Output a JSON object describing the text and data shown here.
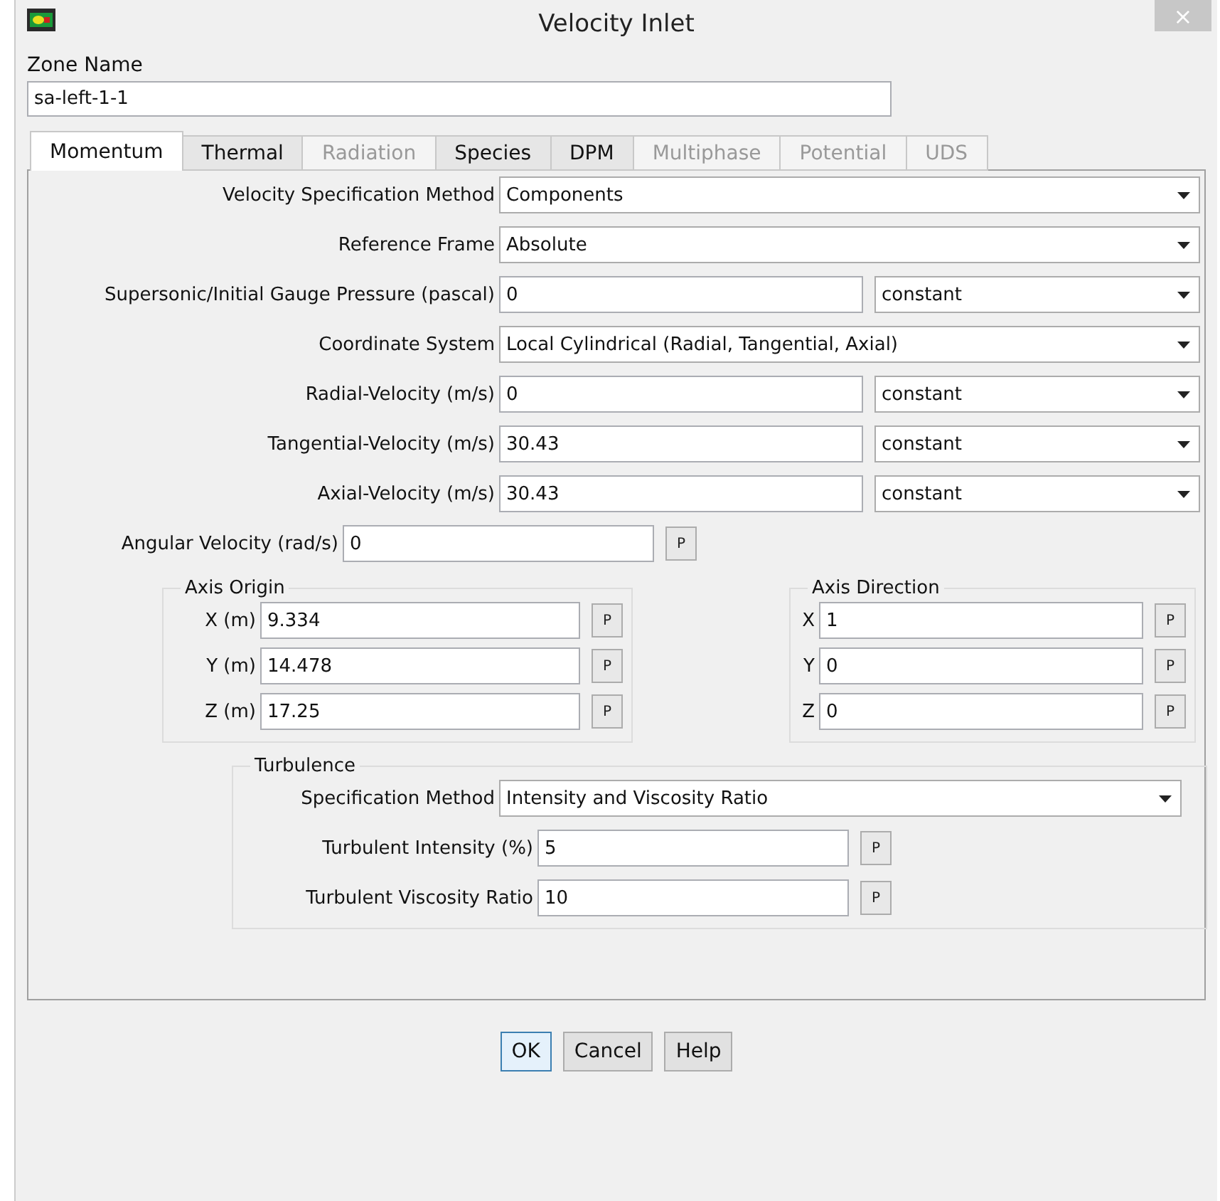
{
  "window": {
    "title": "Velocity Inlet",
    "close": "×"
  },
  "zone": {
    "label": "Zone Name",
    "value": "sa-left-1-1"
  },
  "tabs": [
    {
      "label": "Momentum",
      "selected": true,
      "disabled": false
    },
    {
      "label": "Thermal",
      "selected": false,
      "disabled": false
    },
    {
      "label": "Radiation",
      "selected": false,
      "disabled": true
    },
    {
      "label": "Species",
      "selected": false,
      "disabled": false
    },
    {
      "label": "DPM",
      "selected": false,
      "disabled": false
    },
    {
      "label": "Multiphase",
      "selected": false,
      "disabled": true
    },
    {
      "label": "Potential",
      "selected": false,
      "disabled": true
    },
    {
      "label": "UDS",
      "selected": false,
      "disabled": true
    }
  ],
  "rows": [
    {
      "kind": "select",
      "label": "Velocity Specification Method",
      "value": "Components"
    },
    {
      "kind": "select",
      "label": "Reference Frame",
      "value": "Absolute"
    },
    {
      "kind": "field_method",
      "label": "Supersonic/Initial Gauge Pressure (pascal)",
      "value": "0",
      "method": "constant"
    },
    {
      "kind": "select",
      "label": "Coordinate System",
      "value": "Local Cylindrical (Radial, Tangential, Axial)"
    },
    {
      "kind": "field_method",
      "label": "Radial-Velocity (m/s)",
      "value": "0",
      "method": "constant"
    },
    {
      "kind": "field_method",
      "label": "Tangential-Velocity (m/s)",
      "value": "30.43",
      "method": "constant"
    },
    {
      "kind": "field_method",
      "label": "Axial-Velocity (m/s)",
      "value": "30.43",
      "method": "constant"
    },
    {
      "kind": "field_p",
      "label": "Angular Velocity (rad/s)",
      "value": "0",
      "p": "P"
    }
  ],
  "axis_origin": {
    "title": "Axis Origin",
    "rows": [
      {
        "label": "X (m)",
        "value": "9.334",
        "p": "P"
      },
      {
        "label": "Y (m)",
        "value": "14.478",
        "p": "P"
      },
      {
        "label": "Z (m)",
        "value": "17.25",
        "p": "P"
      }
    ]
  },
  "axis_direction": {
    "title": "Axis Direction",
    "rows": [
      {
        "label": "X",
        "value": "1",
        "p": "P"
      },
      {
        "label": "Y",
        "value": "0",
        "p": "P"
      },
      {
        "label": "Z",
        "value": "0",
        "p": "P"
      }
    ]
  },
  "turbulence": {
    "title": "Turbulence",
    "rows": [
      {
        "kind": "select",
        "label": "Specification Method",
        "value": "Intensity and Viscosity Ratio"
      },
      {
        "kind": "field_p",
        "label": "Turbulent Intensity (%)",
        "value": "5",
        "p": "P"
      },
      {
        "kind": "field_p",
        "label": "Turbulent Viscosity Ratio",
        "value": "10",
        "p": "P"
      }
    ]
  },
  "buttons": [
    {
      "label": "OK",
      "focused": true
    },
    {
      "label": "Cancel",
      "focused": false
    },
    {
      "label": "Help",
      "focused": false
    }
  ]
}
